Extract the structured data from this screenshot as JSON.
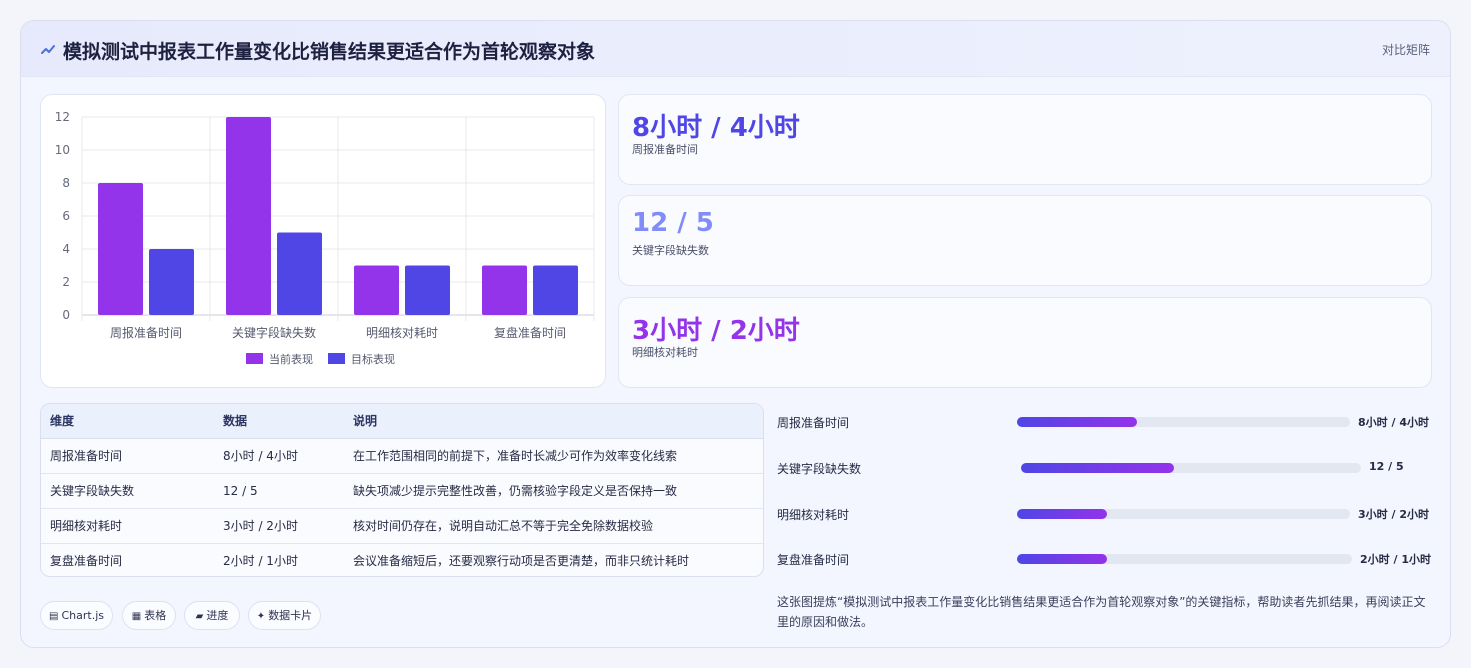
{
  "header": {
    "icon": "zigzag-icon",
    "title": "模拟测试中报表工作量变化比销售结果更适合作为首轮观察对象",
    "link": "对比矩阵"
  },
  "chart_data": {
    "type": "bar",
    "categories": [
      "周报准备时间",
      "关键字段缺失数",
      "明细核对耗时",
      "复盘准备时间"
    ],
    "series": [
      {
        "name": "当前表现",
        "values": [
          8,
          12,
          3,
          3
        ],
        "color": "#9333ea"
      },
      {
        "name": "目标表现",
        "values": [
          4,
          5,
          3,
          3
        ],
        "color": "#4f46e5"
      }
    ],
    "ylim": [
      0,
      12
    ],
    "yticks": [
      0,
      2,
      4,
      6,
      8,
      10,
      12
    ],
    "grid": true,
    "legend": "bottom"
  },
  "metrics": [
    {
      "value": "8小时 / 4小时",
      "label": "周报准备时间",
      "color": "#4f46e5"
    },
    {
      "value": "12 / 5",
      "label": "关键字段缺失数",
      "color": "#818cf8"
    },
    {
      "value": "3小时 / 2小时",
      "label": "明细核对耗时",
      "color": "#9333ea"
    }
  ],
  "table": {
    "headers": [
      "维度",
      "数据",
      "说明"
    ],
    "rows": [
      [
        "周报准备时间",
        "8小时 / 4小时",
        "在工作范围相同的前提下，准备时长减少可作为效率变化线索"
      ],
      [
        "关键字段缺失数",
        "12 / 5",
        "缺失项减少提示完整性改善，仍需核验字段定义是否保持一致"
      ],
      [
        "明细核对耗时",
        "3小时 / 2小时",
        "核对时间仍存在，说明自动汇总不等于完全免除数据校验"
      ],
      [
        "复盘准备时间",
        "2小时 / 1小时",
        "会议准备缩短后，还要观察行动项是否更清楚，而非只统计耗时"
      ]
    ]
  },
  "progress": [
    {
      "label": "周报准备时间",
      "value": "8小时 / 4小时",
      "fraction": 0.36
    },
    {
      "label": "关键字段缺失数",
      "value": "12 / 5",
      "fraction": 0.45
    },
    {
      "label": "明细核对耗时",
      "value": "3小时 / 2小时",
      "fraction": 0.27
    },
    {
      "label": "复盘准备时间",
      "value": "2小时 / 1小时",
      "fraction": 0.27
    }
  ],
  "summary": "这张图提炼“模拟测试中报表工作量变化比销售结果更适合作为首轮观察对象”的关键指标，帮助读者先抓结果，再阅读正文里的原因和做法。",
  "tags": [
    {
      "icon": "▤",
      "label": "Chart.js"
    },
    {
      "icon": "▦",
      "label": "表格"
    },
    {
      "icon": "▰",
      "label": "进度"
    },
    {
      "icon": "✦",
      "label": "数据卡片"
    }
  ]
}
